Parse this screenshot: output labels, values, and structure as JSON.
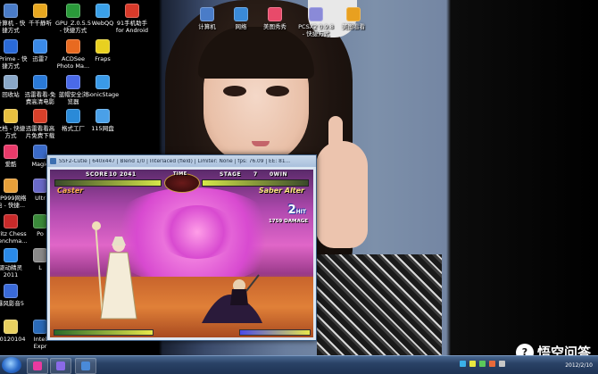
{
  "desktop": {
    "icons_left": [
      {
        "label": "计算机 - 快\n捷方式",
        "color": "#4a7cc8"
      },
      {
        "label": "千千静听",
        "color": "#e8a820"
      },
      {
        "label": "GPU_Z.0.5.5\n- 快捷方式",
        "color": "#2a9a3a"
      },
      {
        "label": "WebQQ",
        "color": "#3aa0e8"
      },
      {
        "label": "91手机助手\nfor Android",
        "color": "#d83a2a"
      },
      {
        "label": "wPrime - 快\n捷方式",
        "color": "#2a6ad8"
      },
      {
        "label": "迅雷7",
        "color": "#3a8ae8"
      },
      {
        "label": "ACDSee\nPhoto Ma...",
        "color": "#e86a20"
      },
      {
        "label": "Fraps",
        "color": "#e8d020"
      },
      {
        "label": "回收站",
        "color": "#8aa8c8"
      },
      {
        "label": "迅雷看看-免\n费高清电影",
        "color": "#2a7ad8"
      },
      {
        "label": "蓝帽安全浏\n览器",
        "color": "#4a6ae8"
      },
      {
        "label": "SonicStage",
        "color": "#3a9ae8"
      },
      {
        "label": "文档 - 快捷\n方式",
        "color": "#e8c040"
      },
      {
        "label": "迅雷看看高\n片免费下载",
        "color": "#d8402a"
      },
      {
        "label": "格式工厂",
        "color": "#2a8ad8"
      },
      {
        "label": "115网盘",
        "color": "#4aa0e8"
      },
      {
        "label": "爱酷",
        "color": "#e83a6a"
      },
      {
        "label": "Magic",
        "color": "#3a6ac8"
      },
      {
        "label": "MP999网络\n电 - 快捷...",
        "color": "#e8a03a"
      },
      {
        "label": "Ultr",
        "color": "#6a6ac8"
      },
      {
        "label": "Fritz Chess\nBenchma...",
        "color": "#c82a2a"
      },
      {
        "label": "Po",
        "color": "#3a8a3a"
      },
      {
        "label": "驱动精灵\n2011",
        "color": "#2a8ae8"
      },
      {
        "label": "L",
        "color": "#8a8a8a"
      },
      {
        "label": "暴风影音5",
        "color": "#3a6ad8"
      },
      {
        "label": "20120104",
        "color": "#e8d060"
      },
      {
        "label": "Intel\nExpr",
        "color": "#2a6ab8"
      }
    ],
    "icons_top": [
      {
        "label": "计算机",
        "color": "#4a7cc8"
      },
      {
        "label": "网络",
        "color": "#3a8ad8"
      },
      {
        "label": "美图秀秀",
        "color": "#e84a6a"
      },
      {
        "label": "PCSX2 0.9.8\n- 快捷方式",
        "color": "#8a8ad8"
      },
      {
        "label": "美图看看",
        "color": "#e8a020"
      }
    ]
  },
  "game_window": {
    "title": "SSF2-Cutie | 640x447 | Blend 1/0 | Interlaced (field) | Limiter: None | fps: 76.09 | EE: 81...",
    "hud": {
      "score_label": "SCORE",
      "score_value": "10 2041",
      "time_label": "TIME",
      "stage_label": "STAGE",
      "stage_value": "7",
      "wins_label": "0WIN",
      "player_left": "Caster",
      "player_right": "Saber Alter",
      "hits_value": "2",
      "hits_label": "HIT",
      "damage_text": "1759 DAMAGE"
    },
    "colors": {
      "left_name": "#ffb050",
      "right_name": "#ffe680"
    }
  },
  "taskbar": {
    "clock_date": "2012/2/10"
  },
  "watermark": {
    "icon_glyph": "?",
    "text": "悟空问答"
  }
}
